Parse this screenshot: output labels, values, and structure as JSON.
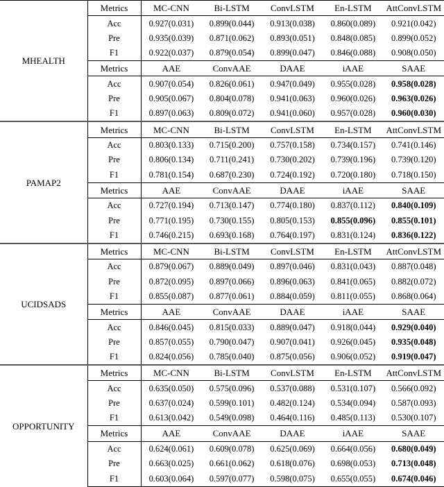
{
  "table": {
    "metrics_header_label": "Metrics",
    "metric_rows": [
      "Acc",
      "Pre",
      "F1"
    ],
    "group_a_columns": [
      "MC-CNN",
      "Bi-LSTM",
      "ConvLSTM",
      "En-LSTM",
      "AttConvLSTM"
    ],
    "group_b_columns": [
      "AAE",
      "ConvAAE",
      "DAAE",
      "iAAE",
      "SAAE"
    ],
    "datasets": [
      {
        "name": "MHEALTH",
        "group_a": {
          "Acc": [
            "0.927(0.031)",
            "0.899(0.044)",
            "0.913(0.038)",
            "0.860(0.089)",
            "0.921(0.042)"
          ],
          "Pre": [
            "0.935(0.039)",
            "0.871(0.062)",
            "0.893(0.051)",
            "0.848(0.085)",
            "0.899(0.052)"
          ],
          "F1": [
            "0.922(0.037)",
            "0.879(0.054)",
            "0.899(0.047)",
            "0.846(0.088)",
            "0.908(0.050)"
          ]
        },
        "group_a_bold": {
          "Acc": [
            false,
            false,
            false,
            false,
            false
          ],
          "Pre": [
            false,
            false,
            false,
            false,
            false
          ],
          "F1": [
            false,
            false,
            false,
            false,
            false
          ]
        },
        "group_b": {
          "Acc": [
            "0.907(0.054)",
            "0.826(0.061)",
            "0.947(0.049)",
            "0.955(0.028)",
            "0.958(0.028)"
          ],
          "Pre": [
            "0.905(0.067)",
            "0.804(0.078)",
            "0.941(0.063)",
            "0.960(0.026)",
            "0.963(0.026)"
          ],
          "F1": [
            "0.897(0.063)",
            "0.809(0.072)",
            "0.941(0.060)",
            "0.957(0.028)",
            "0.960(0.030)"
          ]
        },
        "group_b_bold": {
          "Acc": [
            false,
            false,
            false,
            false,
            true
          ],
          "Pre": [
            false,
            false,
            false,
            false,
            true
          ],
          "F1": [
            false,
            false,
            false,
            false,
            true
          ]
        }
      },
      {
        "name": "PAMAP2",
        "group_a": {
          "Acc": [
            "0.803(0.133)",
            "0.715(0.200)",
            "0.757(0.158)",
            "0.734(0.157)",
            "0.741(0.146)"
          ],
          "Pre": [
            "0.806(0.134)",
            "0.711(0.241)",
            "0.730(0.202)",
            "0.739(0.196)",
            "0.739(0.120)"
          ],
          "F1": [
            "0.781(0.154)",
            "0.687(0.230)",
            "0.724(0.192)",
            "0.720(0.180)",
            "0.718(0.150)"
          ]
        },
        "group_a_bold": {
          "Acc": [
            false,
            false,
            false,
            false,
            false
          ],
          "Pre": [
            false,
            false,
            false,
            false,
            false
          ],
          "F1": [
            false,
            false,
            false,
            false,
            false
          ]
        },
        "group_b": {
          "Acc": [
            "0.727(0.194)",
            "0.713(0.147)",
            "0.774(0.180)",
            "0.837(0.112)",
            "0.840(0.109)"
          ],
          "Pre": [
            "0.771(0.195)",
            "0.730(0.155)",
            "0.805(0.153)",
            "0.855(0.096)",
            "0.855(0.101)"
          ],
          "F1": [
            "0.746(0.215)",
            "0.693(0.168)",
            "0.764(0.197)",
            "0.831(0.124)",
            "0.836(0.122)"
          ]
        },
        "group_b_bold": {
          "Acc": [
            false,
            false,
            false,
            false,
            true
          ],
          "Pre": [
            false,
            false,
            false,
            true,
            true
          ],
          "F1": [
            false,
            false,
            false,
            false,
            true
          ]
        }
      },
      {
        "name": "UCIDSADS",
        "group_a": {
          "Acc": [
            "0.879(0.067)",
            "0.889(0.049)",
            "0.897(0.046)",
            "0.831(0.043)",
            "0.887(0.048)"
          ],
          "Pre": [
            "0.872(0.095)",
            "0.897(0.066)",
            "0.896(0.063)",
            "0.841(0.065)",
            "0.882(0.072)"
          ],
          "F1": [
            "0.855(0.087)",
            "0.877(0.061)",
            "0.884(0.059)",
            "0.811(0.055)",
            "0.868(0.064)"
          ]
        },
        "group_a_bold": {
          "Acc": [
            false,
            false,
            false,
            false,
            false
          ],
          "Pre": [
            false,
            false,
            false,
            false,
            false
          ],
          "F1": [
            false,
            false,
            false,
            false,
            false
          ]
        },
        "group_b": {
          "Acc": [
            "0.846(0.045)",
            "0.815(0.033)",
            "0.889(0.047)",
            "0.918(0.044)",
            "0.929(0.040)"
          ],
          "Pre": [
            "0.857(0.055)",
            "0.790(0.047)",
            "0.907(0.041)",
            "0.926(0.045)",
            "0.935(0.048)"
          ],
          "F1": [
            "0.824(0.056)",
            "0.785(0.040)",
            "0.875(0.056)",
            "0.906(0.052)",
            "0.919(0.047)"
          ]
        },
        "group_b_bold": {
          "Acc": [
            false,
            false,
            false,
            false,
            true
          ],
          "Pre": [
            false,
            false,
            false,
            false,
            true
          ],
          "F1": [
            false,
            false,
            false,
            false,
            true
          ]
        }
      },
      {
        "name": "OPPORTUNITY",
        "group_a": {
          "Acc": [
            "0.635(0.050)",
            "0.575(0.096)",
            "0.537(0.088)",
            "0.531(0.107)",
            "0.566(0.092)"
          ],
          "Pre": [
            "0.637(0.024)",
            "0.599(0.101)",
            "0.482(0.124)",
            "0.534(0.094)",
            "0.587(0.093)"
          ],
          "F1": [
            "0.613(0.042)",
            "0.549(0.098)",
            "0.464(0.116)",
            "0.485(0.113)",
            "0.530(0.107)"
          ]
        },
        "group_a_bold": {
          "Acc": [
            false,
            false,
            false,
            false,
            false
          ],
          "Pre": [
            false,
            false,
            false,
            false,
            false
          ],
          "F1": [
            false,
            false,
            false,
            false,
            false
          ]
        },
        "group_b": {
          "Acc": [
            "0.624(0.061)",
            "0.609(0.078)",
            "0.625(0.069)",
            "0.664(0.056)",
            "0.680(0.049)"
          ],
          "Pre": [
            "0.663(0.025)",
            "0.661(0.062)",
            "0.618(0.076)",
            "0.698(0.053)",
            "0.713(0.048)"
          ],
          "F1": [
            "0.603(0.064)",
            "0.597(0.077)",
            "0.598(0.075)",
            "0.655(0.055)",
            "0.674(0.046)"
          ]
        },
        "group_b_bold": {
          "Acc": [
            false,
            false,
            false,
            false,
            true
          ],
          "Pre": [
            false,
            false,
            false,
            false,
            true
          ],
          "F1": [
            false,
            false,
            false,
            false,
            true
          ]
        }
      }
    ]
  }
}
